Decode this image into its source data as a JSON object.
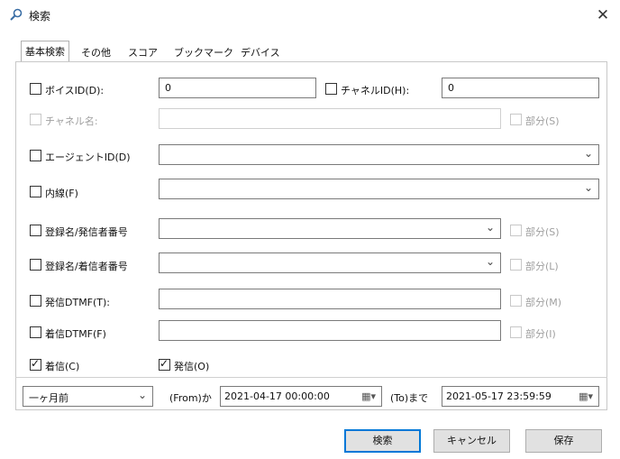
{
  "window": {
    "title": "検索",
    "close_glyph": "✕",
    "icon": "search-icon"
  },
  "tabs": [
    {
      "label": "基本検索",
      "active": true
    },
    {
      "label": "その他"
    },
    {
      "label": "スコア"
    },
    {
      "label": "ブックマーク"
    },
    {
      "label": "デバイス"
    }
  ],
  "form": {
    "voice_id": {
      "label": "ボイスID(D):",
      "value": "0",
      "checked": false
    },
    "channel_id": {
      "label": "チャネルID(H):",
      "value": "0",
      "checked": false
    },
    "channel_name": {
      "label": "チャネル名:",
      "value": "",
      "checked": false,
      "disabled": true,
      "partial_label": "部分(S)"
    },
    "agent_id": {
      "label": "エージェントID(D)",
      "value": "",
      "checked": false
    },
    "extension": {
      "label": "内線(F)",
      "value": "",
      "checked": false
    },
    "caller_name": {
      "label": "登録名/発信者番号",
      "value": "",
      "checked": false,
      "partial_label": "部分(S)"
    },
    "callee_name": {
      "label": "登録名/着信者番号",
      "value": "",
      "checked": false,
      "partial_label": "部分(L)"
    },
    "outgoing_dtmf": {
      "label": "発信DTMF(T):",
      "value": "",
      "checked": false,
      "partial_label": "部分(M)"
    },
    "incoming_dtmf": {
      "label": "着信DTMF(F)",
      "value": "",
      "checked": false,
      "partial_label": "部分(I)"
    },
    "incoming": {
      "label": "着信(C)",
      "checked": true
    },
    "outgoing": {
      "label": "発信(O)",
      "checked": true
    }
  },
  "period": {
    "preset": "一ヶ月前",
    "from_label": "(From)か",
    "from_value": "2021-04-17 00:00:00",
    "to_label": "(To)まで",
    "to_value": "2021-05-17 23:59:59"
  },
  "buttons": {
    "search": "検索",
    "cancel": "キャンセル",
    "save": "保存"
  },
  "glyphs": {
    "chevron": "⌄",
    "calendar": "▦▾"
  }
}
